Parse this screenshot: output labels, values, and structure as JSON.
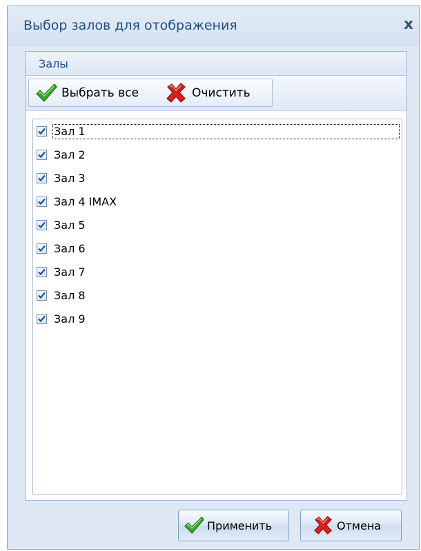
{
  "dialog": {
    "title": "Выбор залов для отображения",
    "close_label": "x"
  },
  "halls_group": {
    "title": "Залы",
    "toolbar": {
      "select_all_label": "Выбрать все",
      "clear_label": "Очистить"
    },
    "items": [
      {
        "label": "Зал 1",
        "checked": true
      },
      {
        "label": "Зал 2",
        "checked": true
      },
      {
        "label": "Зал 3",
        "checked": true
      },
      {
        "label": "Зал 4 IMAX",
        "checked": true
      },
      {
        "label": "Зал 5",
        "checked": true
      },
      {
        "label": "Зал 6",
        "checked": true
      },
      {
        "label": "Зал 7",
        "checked": true
      },
      {
        "label": "Зал 8",
        "checked": true
      },
      {
        "label": "Зал 9",
        "checked": true
      }
    ]
  },
  "footer": {
    "apply_label": "Применить",
    "cancel_label": "Отмена"
  },
  "icons": {
    "check": "checkmark-icon",
    "cross": "red-cross-icon"
  },
  "colors": {
    "title_text": "#1f4e86",
    "check_green": "#3aa52a",
    "cross_red": "#d8201c",
    "checkbox_tick": "#1d4f91"
  }
}
